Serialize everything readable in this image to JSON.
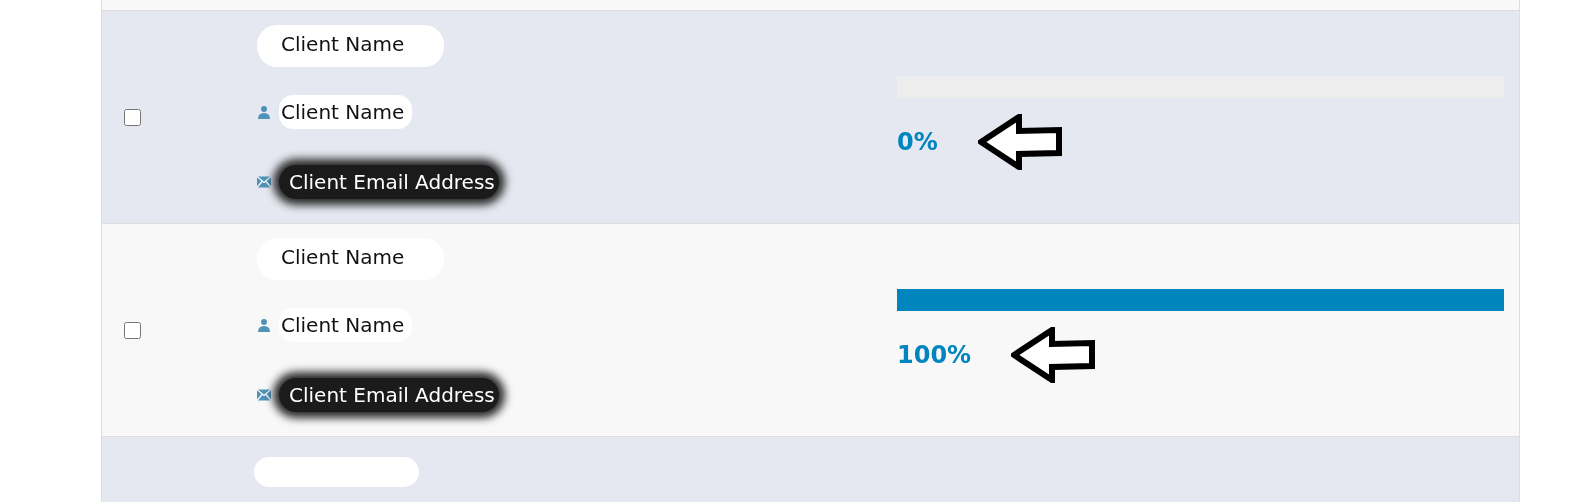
{
  "rows": [
    {
      "checked": false,
      "title": "Client Name",
      "contact": "Client Name",
      "email": "Client Email Address",
      "level": 0,
      "percent": "0%"
    },
    {
      "checked": false,
      "title": "Client Name",
      "contact": "Client Name",
      "email": "Client Email Address",
      "level": 1,
      "percent": "100%"
    }
  ]
}
